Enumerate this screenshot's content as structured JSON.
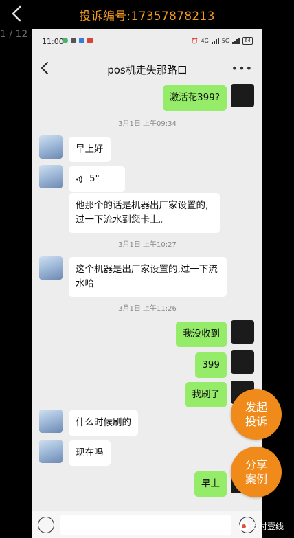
{
  "overlay": {
    "title": "投诉编号:17357878213",
    "page_counter": "1 / 12",
    "watermark": "支付壹线"
  },
  "phone": {
    "statusbar": {
      "time": "11:00",
      "network": "4G",
      "network2": "5G",
      "battery": "64"
    },
    "chat": {
      "title": "pos机走失那路口",
      "messages": [
        {
          "side": "self",
          "text": "激活花399?"
        },
        {
          "timestamp": "3月1日 上午09:34"
        },
        {
          "side": "other",
          "text": "早上好"
        },
        {
          "side": "other",
          "voice_duration": "5\""
        },
        {
          "side": "other",
          "text": "他那个的话是机器出厂家设置的,过一下流水到您卡上。"
        },
        {
          "timestamp": "3月1日 上午10:27"
        },
        {
          "side": "other",
          "text": "这个机器是出厂家设置的,过一下流水哈"
        },
        {
          "timestamp": "3月1日 上午11:26"
        },
        {
          "side": "self",
          "text": "我没收到"
        },
        {
          "side": "self",
          "text": "399"
        },
        {
          "side": "self",
          "text": "我刷了"
        },
        {
          "side": "other",
          "text": "什么时候刷的"
        },
        {
          "side": "other",
          "text": "现在吗"
        },
        {
          "side": "self",
          "text": "早上"
        }
      ]
    },
    "floating_buttons": {
      "complaint": "发起投诉",
      "share": "分享案例"
    }
  },
  "colors": {
    "accent_orange": "#f08a1a",
    "title_orange": "#f39a1f",
    "self_bubble": "#95ec69",
    "chat_bg": "#ededed"
  },
  "icons": [
    "back-icon",
    "voice-icon",
    "more-icon",
    "emoji-icon",
    "voice-input-icon"
  ]
}
